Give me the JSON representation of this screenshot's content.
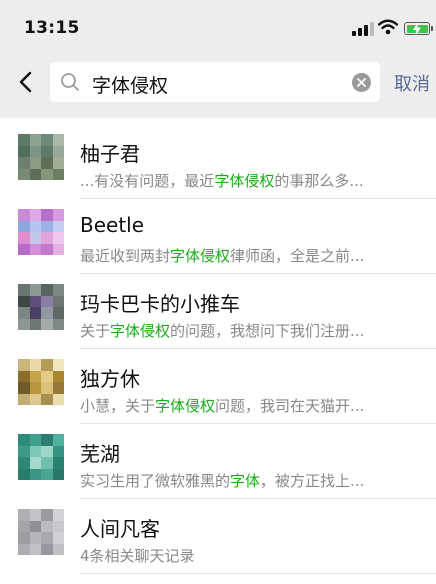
{
  "status_bar": {
    "time": "13:15"
  },
  "search": {
    "query": "字体侵权",
    "cancel_label": "取消"
  },
  "results": [
    {
      "name": "柚子君",
      "before": "...有没有问题，最近",
      "highlight": "字体侵权",
      "after": "的事那么多...",
      "avatar_colors": [
        "#5d7a66",
        "#8ea394",
        "#6f8a7a",
        "#a9b8a9",
        "#4f6e5e",
        "#7d9584",
        "#5e7b6a",
        "#98a99a",
        "#6f7f6e",
        "#8d9a84",
        "#5f6f58",
        "#a3ad98",
        "#788a74",
        "#5c6e57",
        "#849778",
        "#6d7d62"
      ]
    },
    {
      "name": "Beetle",
      "before": "最近收到两封",
      "highlight": "字体侵权",
      "after": "律师函，全是之前...",
      "avatar_colors": [
        "#c98bd7",
        "#e0a7e6",
        "#b56fc9",
        "#d99ae0",
        "#8fa7e0",
        "#b7c3ef",
        "#9bb0e5",
        "#c5cdf0",
        "#e08ccf",
        "#c2c7e8",
        "#e0a6dc",
        "#f0c8ee",
        "#b86ac8",
        "#d58fd8",
        "#c27ad0",
        "#e1b1e4"
      ]
    },
    {
      "name": "玛卡巴卡的小推车",
      "before": "关于",
      "highlight": "字体侵权",
      "after": "的问题，我想问下我们注册...",
      "avatar_colors": [
        "#6a7470",
        "#8c9a93",
        "#5a6462",
        "#7b8883",
        "#3e4744",
        "#604f7a",
        "#8a7ea0",
        "#6c7572",
        "#7c8682",
        "#4a3f64",
        "#9098a0",
        "#5e6866",
        "#8f9794",
        "#6d7672",
        "#a3aaa7",
        "#7f8885"
      ]
    },
    {
      "name": "独方休",
      "before": "小慧，关于",
      "highlight": "字体侵权",
      "after": "问题，我司在天猫开...",
      "avatar_colors": [
        "#c9b57a",
        "#e8dba8",
        "#b39b5a",
        "#f0e6c0",
        "#8a6d2a",
        "#c7a34a",
        "#e2cc86",
        "#a9872f",
        "#6e5a28",
        "#b8963e",
        "#d9c27a",
        "#95793a",
        "#c2ad72",
        "#ddc98f",
        "#a68f4f",
        "#e9dcae"
      ]
    },
    {
      "name": "芜湖",
      "before": "实习生用了微软雅黑的",
      "highlight": "字体",
      "after": "，被方正找上...",
      "avatar_colors": [
        "#2e8b7a",
        "#3fa08e",
        "#2a7e6f",
        "#4fb19e",
        "#3c9a87",
        "#7cc7b6",
        "#9ed6c8",
        "#359381",
        "#2f8776",
        "#a6d9cc",
        "#6fbfad",
        "#2b8170",
        "#2a7c6c",
        "#3b9584",
        "#4aa592",
        "#29786a"
      ]
    },
    {
      "name": "人间凡客",
      "before": "4条相关聊天记录",
      "highlight": "",
      "after": "",
      "avatar_colors": [
        "#b0b0b4",
        "#c4c4c8",
        "#9a9aa0",
        "#d2d2d6",
        "#a3a3a8",
        "#8f8f96",
        "#babac0",
        "#c8c8cc",
        "#9c9ca3",
        "#b5b5ba",
        "#a8a8ae",
        "#d0d0d4",
        "#acacb2",
        "#c0c0c5",
        "#9898a0",
        "#bfbfc4"
      ]
    }
  ]
}
